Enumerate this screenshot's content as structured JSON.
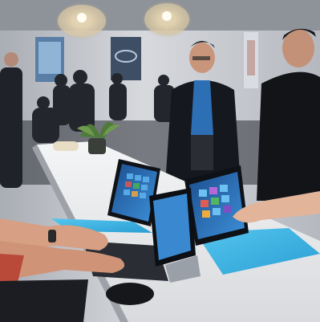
{
  "image": {
    "scene": "product-demo-event",
    "colors": {
      "wall": "#c9ccd1",
      "ceiling": "#8b8f96",
      "table": "#eef0f1",
      "keyboard_cover": "#3fb6e6",
      "screen_tile": "#2b7fd0",
      "suit": "#15181e",
      "shirt_blue": "#2d6fb4",
      "lamp_glow": "#fff4d6",
      "skin": "#d9a58a"
    }
  }
}
